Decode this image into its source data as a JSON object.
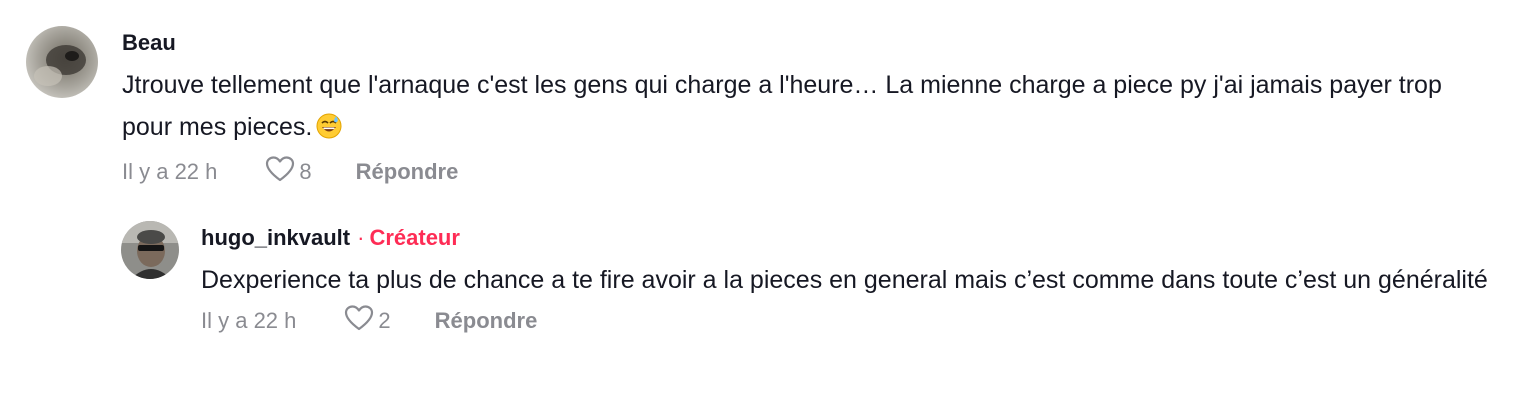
{
  "comments": [
    {
      "username": "Beau",
      "text": "Jtrouve tellement que l'arnaque c'est les gens qui charge a l'heure… La mienne charge a piece py j'ai jamais payer trop pour mes pieces.",
      "emoji": "😅",
      "timestamp": "Il y a 22 h",
      "likes": "8",
      "reply_label": "Répondre"
    },
    {
      "username": "hugo_inkvault",
      "separator": "·",
      "badge": "Créateur",
      "text": "Dexperience ta plus de chance a te fire avoir a la pieces en general mais c’est comme dans toute c’est un généralité",
      "timestamp": "Il y a 22 h",
      "likes": "2",
      "reply_label": "Répondre"
    }
  ],
  "colors": {
    "accent": "#fe2c55",
    "text": "#161823",
    "muted": "#8a8b91"
  },
  "icons": [
    "avatar",
    "heart-icon",
    "grinning-sweat-emoji-icon"
  ]
}
